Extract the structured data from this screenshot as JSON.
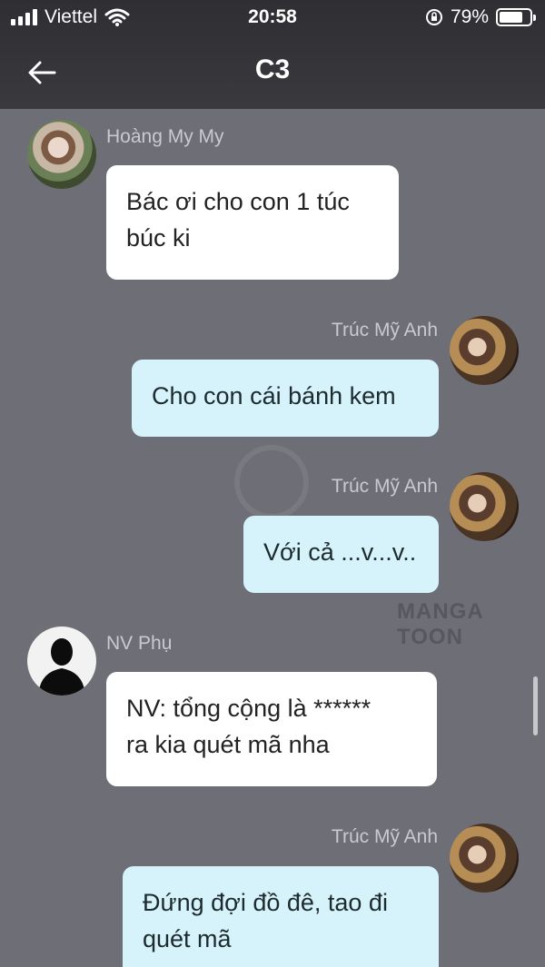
{
  "status_bar": {
    "carrier": "Viettel",
    "time": "20:58",
    "battery": "79%",
    "battery_level": 0.79
  },
  "header": {
    "title": "C3"
  },
  "watermark": "MANGA TOON",
  "messages": [
    {
      "sender": "Hoàng My My",
      "text_lines": [
        "Bác ơi cho con 1 túc",
        "búc ki"
      ]
    },
    {
      "sender": "Trúc Mỹ Anh",
      "text_lines": [
        "Cho con cái bánh kem"
      ]
    },
    {
      "sender": "Trúc Mỹ Anh",
      "text_lines": [
        "Với cả ...v...v.."
      ]
    },
    {
      "sender": "NV Phụ",
      "text_lines": [
        "NV: tổng cộng là ******",
        "ra kia quét mã nha"
      ]
    },
    {
      "sender": "Trúc Mỹ Anh",
      "text_lines": [
        "Đứng đợi đồ đê, tao đi",
        "quét mã"
      ]
    }
  ],
  "icons": {
    "back": "arrow-left-icon",
    "signal": "signal-icon",
    "wifi": "wifi-icon",
    "rotation_lock": "rotation-lock-icon",
    "battery": "battery-icon"
  },
  "colors": {
    "background": "#6e6e76",
    "incoming_bubble": "#ffffff",
    "outgoing_bubble": "#d6f3fc",
    "header": "#353539"
  }
}
